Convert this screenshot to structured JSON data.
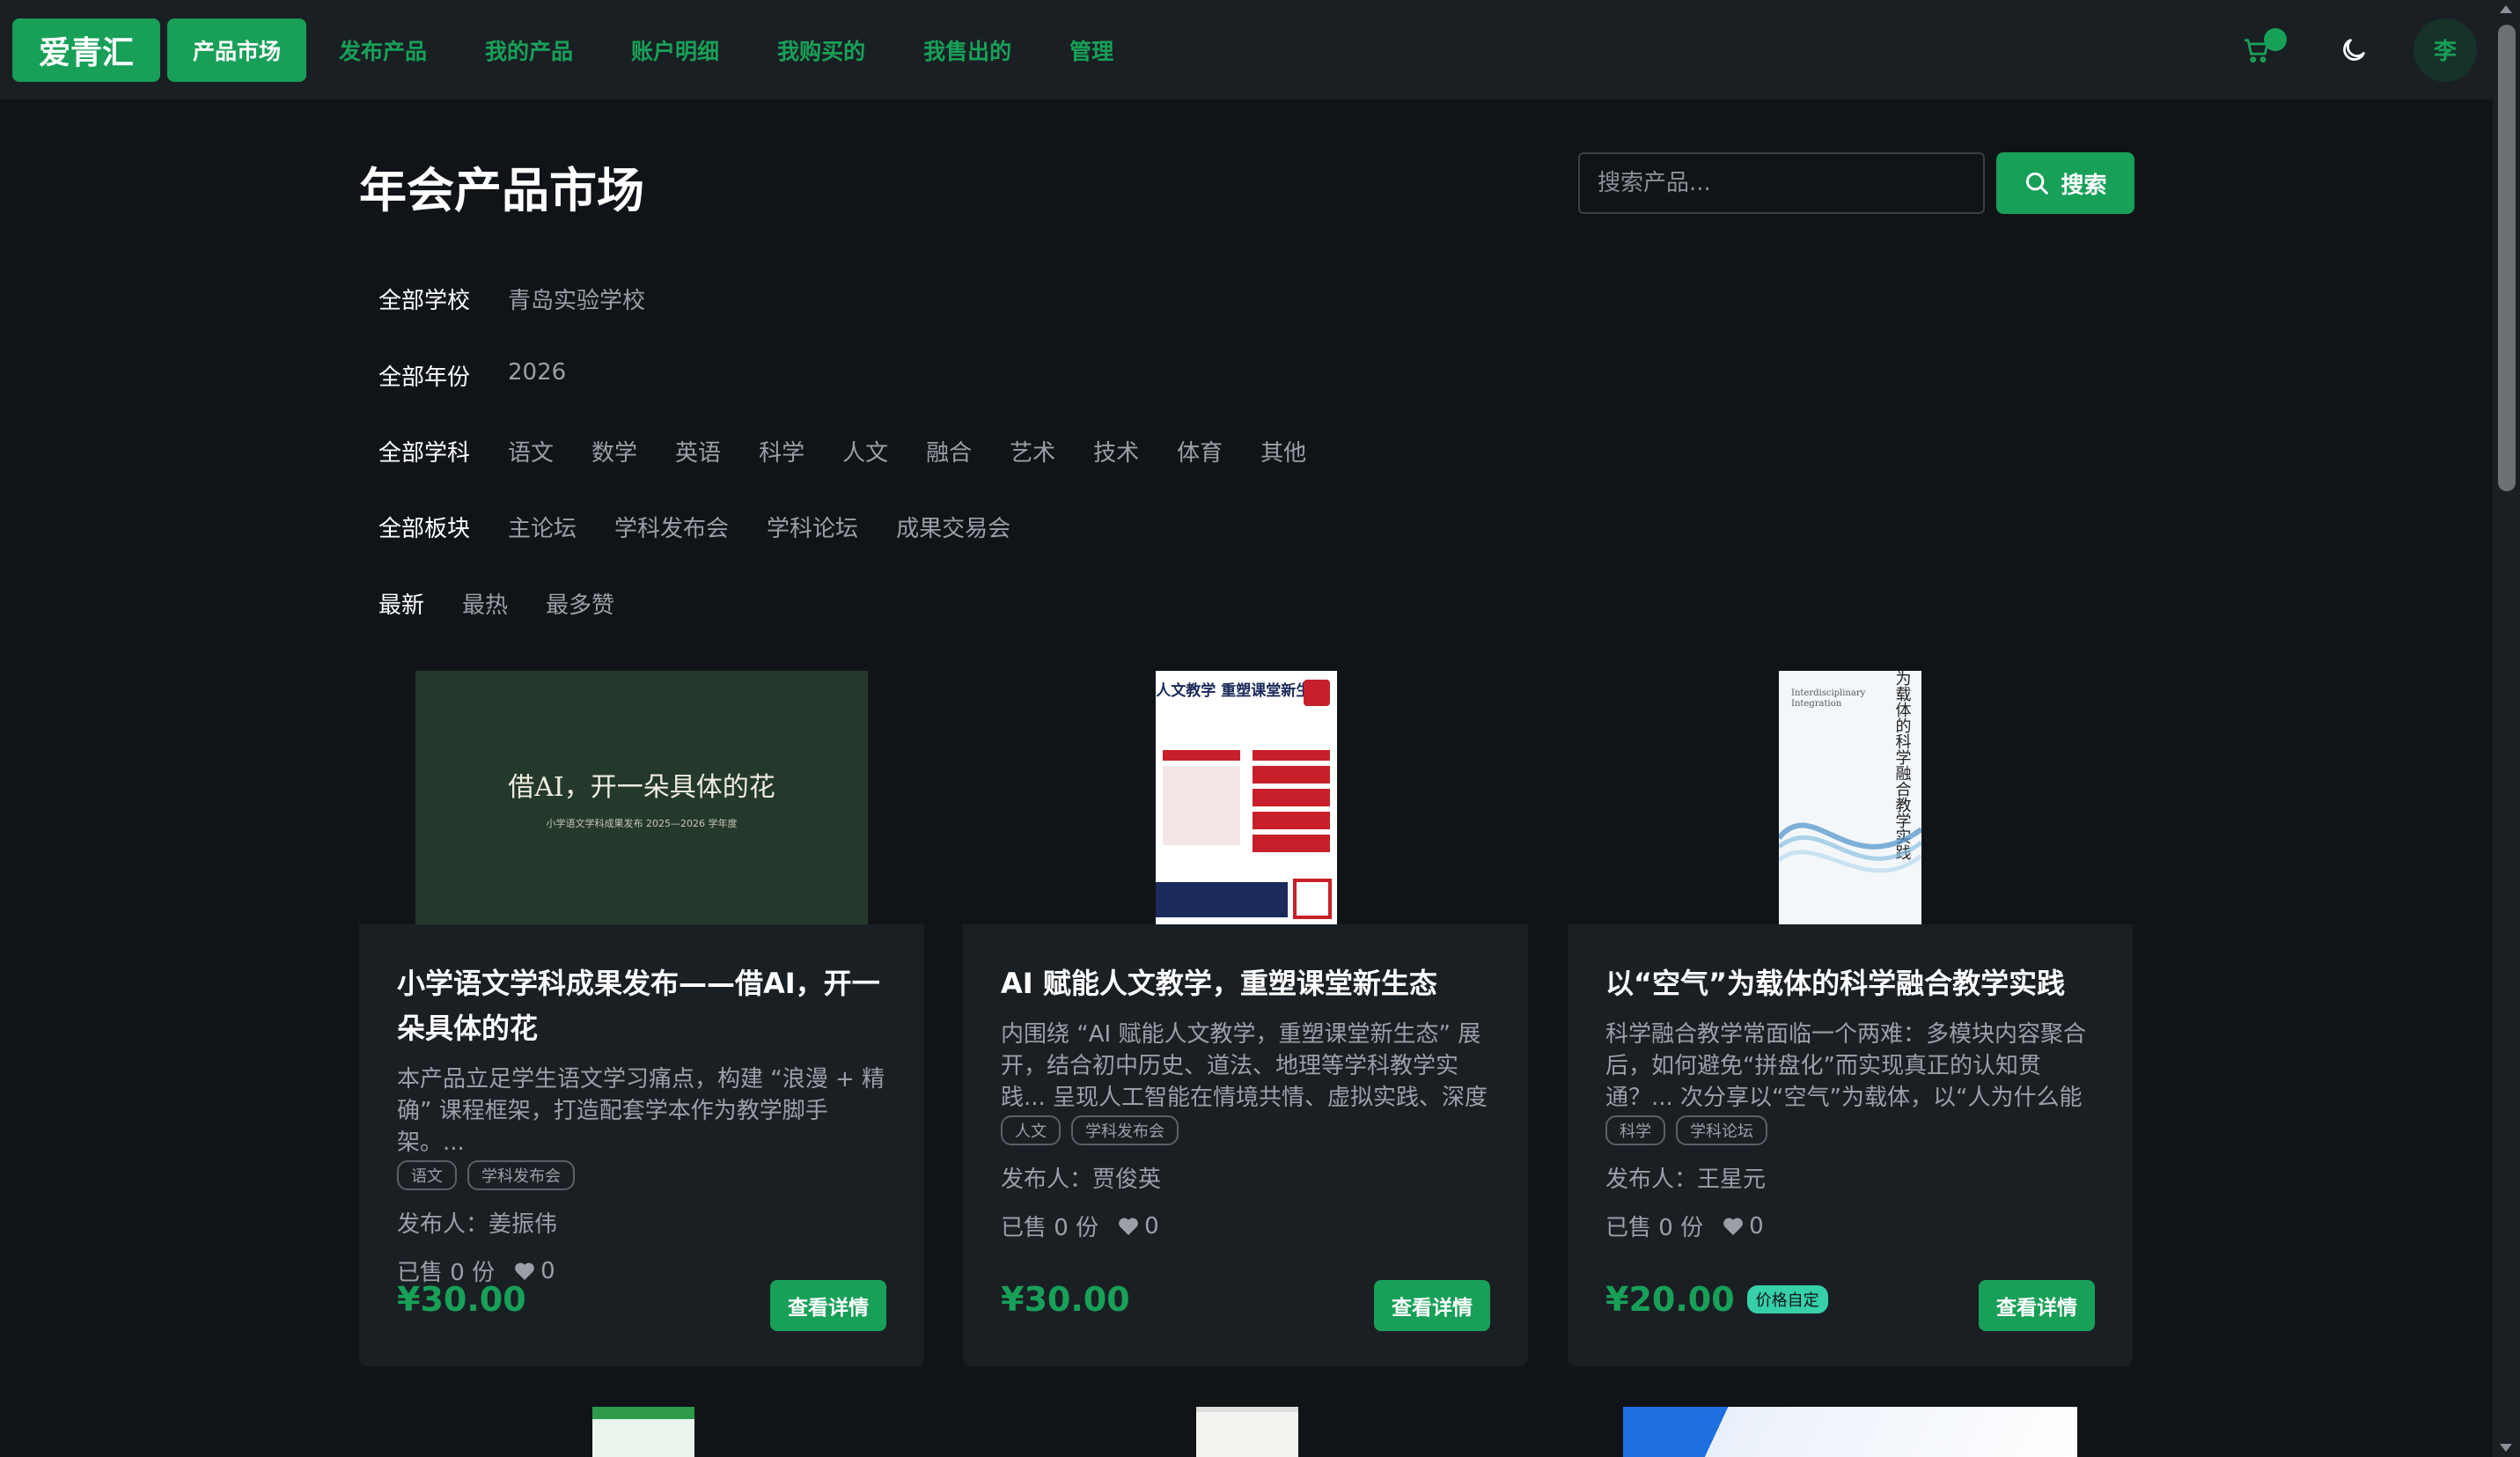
{
  "nav": {
    "logo": "爱青汇",
    "items": [
      "产品市场",
      "发布产品",
      "我的产品",
      "账户明细",
      "我购买的",
      "我售出的",
      "管理"
    ],
    "active_index": 0,
    "avatar_text": "李"
  },
  "header": {
    "title": "年会产品市场",
    "search_placeholder": "搜索产品...",
    "search_button": "搜索"
  },
  "filters": {
    "school": [
      "全部学校",
      "青岛实验学校"
    ],
    "year": [
      "全部年份",
      "2026"
    ],
    "subject": [
      "全部学科",
      "语文",
      "数学",
      "英语",
      "科学",
      "人文",
      "融合",
      "艺术",
      "技术",
      "体育",
      "其他"
    ],
    "section": [
      "全部板块",
      "主论坛",
      "学科发布会",
      "学科论坛",
      "成果交易会"
    ],
    "sort": [
      "最新",
      "最热",
      "最多赞"
    ]
  },
  "cards": [
    {
      "cover_title": "借AI，开一朵具体的花",
      "cover_subtitle": "小学语文学科成果发布 2025—2026 学年度",
      "title": "小学语文学科成果发布——借AI，开一朵具体的花",
      "desc": "本产品立足学生语文学习痛点，构建 “浪漫 + 精确” 课程框架，打造配套学本作为教学脚手架。...",
      "tags": [
        "语文",
        "学科发布会"
      ],
      "publisher": "发布人：姜振伟",
      "sold": "已售 0 份",
      "likes": "0",
      "price": "¥30.00",
      "price_badge": "",
      "button": "查看详情"
    },
    {
      "cover_title": "AI赋能人文教学 重塑课堂新生态",
      "title": "AI 赋能人文教学，重塑课堂新生态",
      "desc": "内围绕 “AI 赋能人文教学，重塑课堂新生态” 展开，结合初中历史、道法、地理等学科教学实践... 呈现人工智能在情境共情、虚拟实践、深度思辨和多元评价中的应用路径",
      "tags": [
        "人文",
        "学科发布会"
      ],
      "publisher": "发布人：贾俊英",
      "sold": "已售 0 份",
      "likes": "0",
      "price": "¥30.00",
      "price_badge": "",
      "button": "查看详情"
    },
    {
      "cover_title": "以空气为载体的科学融合教学实践",
      "title": "以“空气”为载体的科学融合教学实践",
      "desc": "科学融合教学常面临一个两难：多模块内容聚合后，如何避免“拼盘化”而实现真正的认知贯通？... 次分享以“空气”为载体，以“人为什么能呼吸”这一真实问题为锚点，呈现",
      "tags": [
        "科学",
        "学科论坛"
      ],
      "publisher": "发布人：王星元",
      "sold": "已售 0 份",
      "likes": "0",
      "price": "¥20.00",
      "price_badge": "价格自定",
      "button": "查看详情"
    }
  ],
  "colors": {
    "accent": "#18a058",
    "background": "#101418",
    "surface": "#1a1f24"
  },
  "icons": {
    "cart": "cart-icon",
    "theme": "moon-icon",
    "search": "search-icon",
    "like": "heart-icon"
  }
}
